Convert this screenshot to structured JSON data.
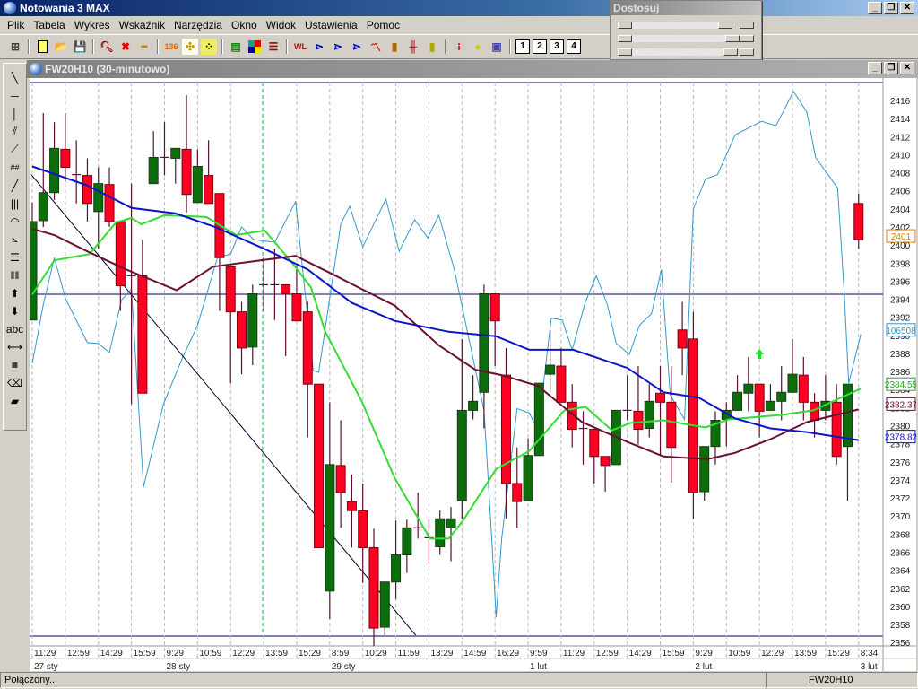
{
  "app": {
    "title": "Notowania 3 MAX"
  },
  "menu": [
    "Plik",
    "Tabela",
    "Wykres",
    "Wskaźnik",
    "Narzędzia",
    "Okno",
    "Widok",
    "Ustawienia",
    "Pomoc"
  ],
  "toolbar": {
    "layout_buttons": [
      "1",
      "2",
      "3",
      "4"
    ]
  },
  "panel": {
    "title": "Dostosuj"
  },
  "chart_window": {
    "title": "FW20H10 (30-minutowo)"
  },
  "left_tools": {
    "text_tool": "abc"
  },
  "status": {
    "left": "Połączony...",
    "right": "FW20H10"
  },
  "colors": {
    "bull": "#0b6e0b",
    "bear": "#ff0022",
    "ma_short": "#33dd33",
    "ma_mid": "#6b1030",
    "ma_long": "#0a14c8",
    "overlay": "#3399cc",
    "trend": "#000033"
  },
  "chart_data": {
    "type": "candlestick",
    "symbol": "FW20H10",
    "interval": "30-minutowo",
    "ylim": [
      2356,
      2416
    ],
    "y_ticks_step": 2,
    "time_labels": [
      "11:29",
      "12:59",
      "14:29",
      "15:59",
      "9:29",
      "10:59",
      "12:29",
      "13:59",
      "15:29",
      "8:59",
      "10:29",
      "11:59",
      "13:29",
      "14:59",
      "16:29",
      "9:59",
      "11:29",
      "12:59",
      "14:29",
      "15:59",
      "9:29",
      "10:59",
      "12:29",
      "13:59",
      "15:29",
      "8:34"
    ],
    "time_label_every_bars": 3,
    "date_labels": [
      {
        "label": "27 sty",
        "at": 0
      },
      {
        "label": "28 sty",
        "at": 4
      },
      {
        "label": "29 sty",
        "at": 9
      },
      {
        "label": "1 lut",
        "at": 15
      },
      {
        "label": "2 lut",
        "at": 20
      },
      {
        "label": "3 lut",
        "at": 25
      }
    ],
    "ohlc": [
      [
        2391.7,
        2404.7,
        2391.7,
        2402.6
      ],
      [
        2402.7,
        2414.6,
        2402,
        2405.8
      ],
      [
        2405.8,
        2413.6,
        2405,
        2410.7
      ],
      [
        2410.6,
        2414.6,
        2407,
        2408.6
      ],
      [
        2407.8,
        2411.6,
        2404.6,
        2407.8
      ],
      [
        2407.7,
        2409.6,
        2402.6,
        2404.6
      ],
      [
        2403.7,
        2408.6,
        2399.6,
        2406.8
      ],
      [
        2406.7,
        2408.6,
        2402,
        2402.6
      ],
      [
        2402.6,
        2402.6,
        2392.7,
        2395.5
      ],
      [
        2396.6,
        2406.8,
        2382.4,
        2396.6
      ],
      [
        2396.6,
        2400.6,
        2383.6,
        2383.6
      ],
      [
        2406.8,
        2412.6,
        2406.8,
        2409.7
      ],
      [
        2409.7,
        2413.6,
        2407.7,
        2409.7
      ],
      [
        2409.6,
        2410.7,
        2406.8,
        2410.7
      ],
      [
        2410.6,
        2416.6,
        2403.6,
        2405.6
      ],
      [
        2404.7,
        2410.6,
        2404.7,
        2408.7
      ],
      [
        2407.7,
        2411.6,
        2404.6,
        2404.6
      ],
      [
        2405.7,
        2405.7,
        2392.7,
        2398.6
      ],
      [
        2397.6,
        2397.6,
        2384.7,
        2392.6
      ],
      [
        2392.6,
        2393.7,
        2385.7,
        2388.6
      ],
      [
        2388.7,
        2395.6,
        2386.7,
        2394.6
      ],
      [
        2395.6,
        2398.6,
        2392.7,
        2395.6
      ],
      [
        2395.6,
        2399.6,
        2391.7,
        2395.6
      ],
      [
        2395.6,
        2395.6,
        2387.7,
        2394.6
      ],
      [
        2394.6,
        2397.6,
        2391.6,
        2391.6
      ],
      [
        2392.6,
        2393.7,
        2378.7,
        2384.6
      ],
      [
        2384.6,
        2384.6,
        2366.5,
        2366.5
      ],
      [
        2361.7,
        2382.6,
        2358.6,
        2375.7
      ],
      [
        2375.6,
        2380.6,
        2368.7,
        2372.6
      ],
      [
        2371.6,
        2374.6,
        2366.5,
        2370.6
      ],
      [
        2370.6,
        2373.6,
        2362.6,
        2366.5
      ],
      [
        2366.5,
        2368.6,
        2355.6,
        2357.6
      ],
      [
        2357.7,
        2362.7,
        2356.8,
        2362.7
      ],
      [
        2362.7,
        2369.5,
        2360.8,
        2365.7
      ],
      [
        2365.7,
        2369.6,
        2363.7,
        2368.7
      ],
      [
        2368.7,
        2372.6,
        2367.5,
        2368.7
      ],
      [
        2367.6,
        2369.6,
        2364.7,
        2367.6
      ],
      [
        2366.6,
        2370.6,
        2365.7,
        2369.7
      ],
      [
        2368.7,
        2371,
        2365,
        2369.7
      ],
      [
        2371.7,
        2389.6,
        2369.7,
        2381.7
      ],
      [
        2381.7,
        2385.6,
        2380.7,
        2382.7
      ],
      [
        2383.7,
        2395.6,
        2379.7,
        2394.6
      ],
      [
        2394.6,
        2394.6,
        2386.6,
        2391.6
      ],
      [
        2385.6,
        2388.6,
        2369.7,
        2373.6
      ],
      [
        2373.6,
        2377.6,
        2368.7,
        2371.6
      ],
      [
        2371.7,
        2378.6,
        2371.7,
        2376.7
      ],
      [
        2376.7,
        2384.7,
        2376.7,
        2384.7
      ],
      [
        2385.7,
        2390.6,
        2383.7,
        2386.7
      ],
      [
        2386.6,
        2388.6,
        2382.6,
        2382.6
      ],
      [
        2382.6,
        2384.6,
        2377.6,
        2379.6
      ],
      [
        2379.7,
        2381.6,
        2375.7,
        2379.7
      ],
      [
        2379.6,
        2379.6,
        2373.6,
        2376.6
      ],
      [
        2376.6,
        2376.6,
        2372.7,
        2375.6
      ],
      [
        2375.7,
        2381.7,
        2375.7,
        2381.7
      ],
      [
        2381.7,
        2385.6,
        2380.6,
        2381.7
      ],
      [
        2381.6,
        2386.6,
        2377.9,
        2379.6
      ],
      [
        2379.7,
        2384.6,
        2378.7,
        2382.7
      ],
      [
        2383.6,
        2386.6,
        2376.7,
        2382.6
      ],
      [
        2382.6,
        2386.6,
        2373.7,
        2377.6
      ],
      [
        2390.6,
        2393.7,
        2385.6,
        2388.6
      ],
      [
        2389.6,
        2392.6,
        2369.7,
        2372.6
      ],
      [
        2372.7,
        2377.7,
        2371.7,
        2377.7
      ],
      [
        2377.7,
        2381.6,
        2375.7,
        2380.6
      ],
      [
        2380.7,
        2382.6,
        2377.7,
        2381.7
      ],
      [
        2381.7,
        2385.6,
        2381.7,
        2383.7
      ],
      [
        2383.6,
        2387.6,
        2381.6,
        2384.6
      ],
      [
        2384.6,
        2384.6,
        2378.7,
        2381.6
      ],
      [
        2381.7,
        2384.6,
        2381.7,
        2382.7
      ],
      [
        2382.7,
        2386.6,
        2380.6,
        2383.7
      ],
      [
        2383.7,
        2389.6,
        2383.7,
        2385.7
      ],
      [
        2385.6,
        2387.6,
        2380.6,
        2382.6
      ],
      [
        2382.6,
        2383.6,
        2378.7,
        2380.6
      ],
      [
        2381.7,
        2385.6,
        2380.6,
        2382.7
      ],
      [
        2382.6,
        2384.6,
        2375.7,
        2376.6
      ],
      [
        2377.7,
        2384.6,
        2371.7,
        2384.6
      ],
      [
        2404.6,
        2405.7,
        2399.6,
        2400.6
      ]
    ],
    "series": [
      {
        "name": "ma_long",
        "color": "#0a14c8",
        "last_label": "2378.82",
        "points": [
          [
            0,
            2408.7
          ],
          [
            5,
            2406.6
          ],
          [
            9,
            2404.1
          ],
          [
            13,
            2403.5
          ],
          [
            16.6,
            2402
          ],
          [
            21,
            2399.6
          ],
          [
            25,
            2397.3
          ],
          [
            29,
            2393.6
          ],
          [
            32.9,
            2391.6
          ],
          [
            37.8,
            2390.4
          ],
          [
            42.1,
            2389.9
          ],
          [
            45.1,
            2388.4
          ],
          [
            49.1,
            2388.4
          ],
          [
            54,
            2386.4
          ],
          [
            57.3,
            2383.7
          ],
          [
            60.5,
            2383.1
          ],
          [
            63.8,
            2380.8
          ],
          [
            67,
            2379.7
          ],
          [
            70.3,
            2379.3
          ],
          [
            75,
            2378.4
          ]
        ]
      },
      {
        "name": "ma_mid",
        "color": "#6b1030",
        "last_label": "2382.37",
        "points": [
          [
            0,
            2401.8
          ],
          [
            2,
            2401.1
          ],
          [
            5,
            2399.3
          ],
          [
            8.5,
            2397.3
          ],
          [
            13.1,
            2395
          ],
          [
            16.4,
            2397.6
          ],
          [
            20.7,
            2398.3
          ],
          [
            23.9,
            2398.8
          ],
          [
            27.2,
            2396.8
          ],
          [
            29.6,
            2395.3
          ],
          [
            32.9,
            2393.3
          ],
          [
            36.9,
            2388.9
          ],
          [
            40.2,
            2386.2
          ],
          [
            42.6,
            2385.6
          ],
          [
            45.9,
            2384.4
          ],
          [
            49.9,
            2380.4
          ],
          [
            54,
            2378.2
          ],
          [
            57.3,
            2376.6
          ],
          [
            61.3,
            2376.3
          ],
          [
            63.8,
            2377
          ],
          [
            67,
            2378.5
          ],
          [
            70.3,
            2380.4
          ],
          [
            75,
            2381.8
          ]
        ]
      },
      {
        "name": "ma_short",
        "color": "#33dd33",
        "last_label": "2384.55",
        "points": [
          [
            0,
            2394.5
          ],
          [
            2,
            2398.3
          ],
          [
            5.2,
            2399
          ],
          [
            7.6,
            2402.5
          ],
          [
            9,
            2403
          ],
          [
            9.9,
            2402.3
          ],
          [
            12,
            2403.3
          ],
          [
            15.8,
            2403.1
          ],
          [
            18.5,
            2401.1
          ],
          [
            21.1,
            2401.6
          ],
          [
            23.4,
            2398.3
          ],
          [
            25.3,
            2395.3
          ],
          [
            26.6,
            2390.4
          ],
          [
            29.9,
            2382.7
          ],
          [
            32.9,
            2374.2
          ],
          [
            36.1,
            2367.5
          ],
          [
            37.8,
            2367.5
          ],
          [
            39.1,
            2369.5
          ],
          [
            42.1,
            2375.2
          ],
          [
            45.1,
            2377.2
          ],
          [
            48.3,
            2381.7
          ],
          [
            50.2,
            2382.1
          ],
          [
            52.6,
            2379.5
          ],
          [
            54.3,
            2380.3
          ],
          [
            57.3,
            2380.6
          ],
          [
            61.1,
            2379.8
          ],
          [
            63.2,
            2380.7
          ],
          [
            68.1,
            2381.2
          ],
          [
            70.9,
            2381.7
          ],
          [
            72.5,
            2382.6
          ],
          [
            75.2,
            2384.1
          ]
        ]
      },
      {
        "name": "overlay",
        "color": "#3399cc",
        "last_label": "106508",
        "points": [
          [
            0,
            2386.9
          ],
          [
            1,
            2393.4
          ],
          [
            2,
            2398.6
          ],
          [
            3,
            2394.1
          ],
          [
            5,
            2389.2
          ],
          [
            6,
            2389.1
          ],
          [
            7,
            2388.1
          ],
          [
            8.1,
            2393.9
          ],
          [
            9,
            2395.1
          ],
          [
            10.1,
            2373.2
          ],
          [
            11.9,
            2382.4
          ],
          [
            13.6,
            2387.4
          ],
          [
            15,
            2391.1
          ],
          [
            16.8,
            2398.6
          ],
          [
            18,
            2399
          ],
          [
            19,
            2402
          ],
          [
            20.1,
            2400.6
          ],
          [
            22,
            2400.3
          ],
          [
            23.9,
            2404.8
          ],
          [
            25.5,
            2386.1
          ],
          [
            26,
            2385.9
          ],
          [
            28,
            2402.3
          ],
          [
            28.8,
            2404.3
          ],
          [
            30,
            2399.8
          ],
          [
            32.1,
            2405.1
          ],
          [
            33.3,
            2399.3
          ],
          [
            34.7,
            2402.8
          ],
          [
            35.9,
            2400.8
          ],
          [
            36.9,
            2403.3
          ],
          [
            38.3,
            2397.3
          ],
          [
            41,
            2381.7
          ],
          [
            41.7,
            2367.5
          ],
          [
            42.1,
            2358.8
          ],
          [
            42.6,
            2367.5
          ],
          [
            44,
            2381.9
          ],
          [
            45.1,
            2381.4
          ],
          [
            45.9,
            2379.5
          ],
          [
            47.1,
            2391.9
          ],
          [
            48.1,
            2391.7
          ],
          [
            49,
            2388.4
          ],
          [
            50.2,
            2393.7
          ],
          [
            51.2,
            2396.6
          ],
          [
            52.2,
            2393.4
          ],
          [
            53,
            2389.1
          ],
          [
            54.2,
            2387.9
          ],
          [
            55.1,
            2391.1
          ],
          [
            56.2,
            2392.4
          ],
          [
            57.1,
            2397.3
          ],
          [
            57.9,
            2383.4
          ],
          [
            59.2,
            2380.7
          ],
          [
            60,
            2404
          ],
          [
            61.1,
            2407.3
          ],
          [
            62.2,
            2407.8
          ],
          [
            63.8,
            2412.2
          ],
          [
            66.2,
            2413.7
          ],
          [
            67.5,
            2413.2
          ],
          [
            69.1,
            2417
          ],
          [
            70.3,
            2414.7
          ],
          [
            71.1,
            2409.7
          ],
          [
            73.1,
            2406.3
          ],
          [
            73.7,
            2394.6
          ],
          [
            74.1,
            2384.7
          ],
          [
            75.2,
            2390.1
          ]
        ]
      }
    ],
    "last_price_label": "2401",
    "horizontal_line": 2394.55,
    "trendline": [
      [
        -0.1,
        2407.8
      ],
      [
        34.8,
        2356.8
      ]
    ],
    "marker_bar": 20.9,
    "signal_arrow": {
      "bar": 66,
      "price": 2387.9
    }
  }
}
